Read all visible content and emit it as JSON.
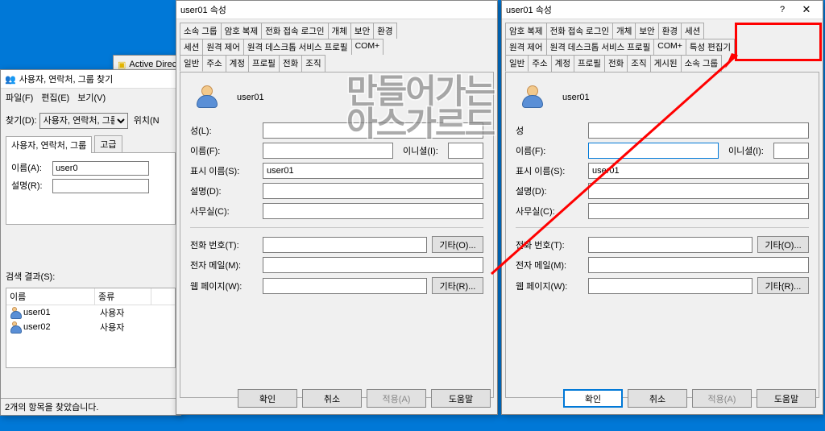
{
  "ad_title": "Active Directo",
  "find": {
    "title": "사용자, 연락처, 그룹 찾기",
    "menu_file": "파일(F)",
    "menu_edit": "편집(E)",
    "menu_view": "보기(V)",
    "find_label": "찾기(D):",
    "find_value": "사용자, 연락처, 그룹",
    "loc_label": "위치(N",
    "tab_basic": "사용자, 연락처, 그룹",
    "tab_adv": "고급",
    "name_label": "이름(A):",
    "name_value": "user0",
    "desc_label": "설명(R):",
    "results_label": "검색 결과(S):",
    "col_name": "이름",
    "col_type": "종류",
    "rows": [
      {
        "name": "user01",
        "type": "사용자"
      },
      {
        "name": "user02",
        "type": "사용자"
      }
    ],
    "status": "2개의 항목을 찾았습니다."
  },
  "props_left": {
    "title": "user01 속성",
    "tabs_r1": [
      "소속 그룹",
      "암호 복제",
      "전화 접속 로그인",
      "개체",
      "보안",
      "환경"
    ],
    "tabs_r2": [
      "세션",
      "원격 제어",
      "원격 데스크톱 서비스 프로필",
      "COM+"
    ],
    "tabs_r3": [
      "일반",
      "주소",
      "계정",
      "프로필",
      "전화",
      "조직"
    ],
    "user_display": "user01",
    "f_lname": "성(L):",
    "f_fname": "이름(F):",
    "f_ini": "이니셜(I):",
    "f_disp": "표시 이름(S):",
    "f_disp_val": "user01",
    "f_desc": "설명(D):",
    "f_office": "사무실(C):",
    "f_phone": "전화 번호(T):",
    "f_email": "전자 메일(M):",
    "f_web": "웹 페이지(W):",
    "btn_other_o": "기타(O)...",
    "btn_other_r": "기타(R)...",
    "btn_ok": "확인",
    "btn_cancel": "취소",
    "btn_apply": "적용(A)",
    "btn_help": "도움말"
  },
  "props_right": {
    "title": "user01 속성",
    "tabs_r1": [
      "암호 복제",
      "전화 접속 로그인",
      "개체",
      "보안",
      "환경",
      "세션"
    ],
    "tabs_r2": [
      "원격 제어",
      "원격 데스크톱 서비스 프로필",
      "COM+",
      "특성 편집기"
    ],
    "tabs_r3": [
      "일반",
      "주소",
      "계정",
      "프로필",
      "전화",
      "조직",
      "게시된",
      "소속 그룹"
    ],
    "user_display": "user01",
    "f_lname": "성",
    "f_fname": "이름(F):",
    "f_ini": "이니셜(I):",
    "f_disp": "표시 이름(S):",
    "f_disp_val": "user01",
    "f_desc": "설명(D):",
    "f_office": "사무실(C):",
    "f_phone": "전화 번호(T):",
    "f_email": "전자 메일(M):",
    "f_web": "웹 페이지(W):",
    "btn_other_o": "기타(O)...",
    "btn_other_r": "기타(R)...",
    "btn_ok": "확인",
    "btn_cancel": "취소",
    "btn_apply": "적용(A)",
    "btn_help": "도움말"
  },
  "highlight_tab": "특성 편집기"
}
